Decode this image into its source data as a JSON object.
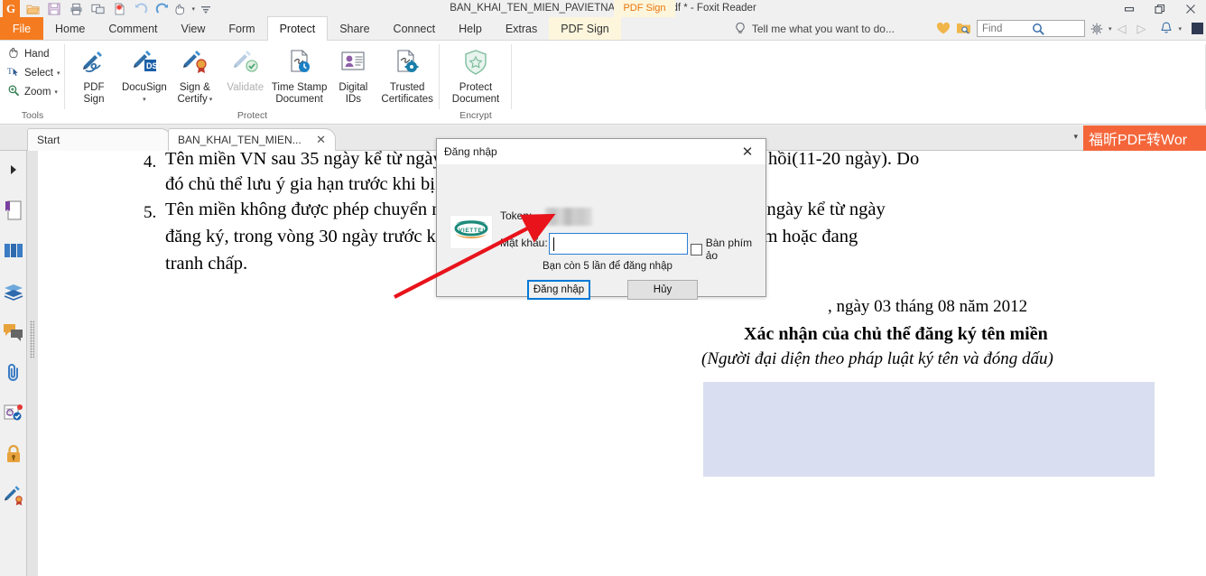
{
  "window": {
    "title": "BAN_KHAI_TEN_MIEN_PAVIETNAM.NET.VN.pdf * - Foxit Reader",
    "pdf_sign_badge": "PDF Sign",
    "quick_access": [
      {
        "name": "foxit-logo-icon",
        "glyph": "G"
      },
      {
        "name": "open-icon",
        "glyph": "▰"
      },
      {
        "name": "save-icon",
        "glyph": "▣"
      },
      {
        "name": "print-icon",
        "glyph": "⎙"
      },
      {
        "name": "email-icon",
        "glyph": "❐"
      },
      {
        "name": "new-from-clipboard-icon",
        "glyph": "⁂"
      },
      {
        "name": "undo-icon",
        "glyph": "↶"
      },
      {
        "name": "redo-icon",
        "glyph": "↷"
      },
      {
        "name": "hand-tool-icon",
        "glyph": "☚"
      },
      {
        "name": "customize-qat-icon",
        "glyph": "≡"
      }
    ],
    "controls": [
      {
        "name": "minimize-button",
        "glyph": "—"
      },
      {
        "name": "restore-button",
        "glyph": "❐"
      },
      {
        "name": "close-button",
        "glyph": "✕"
      }
    ]
  },
  "menu": {
    "file_label": "File",
    "items": [
      {
        "label": "Home",
        "active": false
      },
      {
        "label": "Comment",
        "active": false
      },
      {
        "label": "View",
        "active": false
      },
      {
        "label": "Form",
        "active": false
      },
      {
        "label": "Protect",
        "active": true
      },
      {
        "label": "Share",
        "active": false
      },
      {
        "label": "Connect",
        "active": false
      },
      {
        "label": "Help",
        "active": false
      },
      {
        "label": "Extras",
        "active": false
      },
      {
        "label": "PDF Sign",
        "active": false
      }
    ],
    "tell_me": "Tell me what you want to do...",
    "find_placeholder": "Find",
    "icons": {
      "lightbulb": "lightbulb-icon",
      "heart": "heart-icon",
      "folder_search": "folder-search-icon",
      "settings": "gear-icon",
      "prev": "back-arrow-icon",
      "next": "forward-arrow-icon",
      "bell": "bell-icon"
    }
  },
  "ribbon": {
    "groups": [
      {
        "label": "Tools",
        "buttons": [
          {
            "label": "Hand",
            "icon": "hand-icon",
            "caret": false,
            "disabled": false
          },
          {
            "label": "Select",
            "icon": "select-text-icon",
            "caret": true,
            "disabled": false
          },
          {
            "label": "Zoom",
            "icon": "zoom-icon",
            "caret": true,
            "disabled": false
          }
        ]
      },
      {
        "label": "Protect",
        "buttons": [
          {
            "label": "PDF\nSign",
            "line1": "PDF",
            "line2": "Sign",
            "icon": "pdf-sign-icon",
            "caret": false,
            "disabled": false
          },
          {
            "label": "DocuSign",
            "line1": "DocuSign",
            "line2": "",
            "icon": "docusign-icon",
            "caret": true,
            "disabled": false
          },
          {
            "label": "Sign & Certify",
            "line1": "Sign &",
            "line2": "Certify",
            "icon": "sign-certify-icon",
            "caret": true,
            "disabled": false
          },
          {
            "label": "Validate",
            "line1": "Validate",
            "line2": "",
            "icon": "validate-icon",
            "caret": false,
            "disabled": true
          },
          {
            "label": "Time Stamp Document",
            "line1": "Time Stamp",
            "line2": "Document",
            "icon": "time-stamp-icon",
            "caret": false,
            "disabled": false
          },
          {
            "label": "Digital IDs",
            "line1": "Digital",
            "line2": "IDs",
            "icon": "digital-ids-icon",
            "caret": false,
            "disabled": false
          },
          {
            "label": "Trusted Certificates",
            "line1": "Trusted",
            "line2": "Certificates",
            "icon": "trusted-certificates-icon",
            "caret": false,
            "disabled": false
          }
        ]
      },
      {
        "label": "Encrypt",
        "buttons": [
          {
            "label": "Protect Document",
            "line1": "Protect",
            "line2": "Document",
            "icon": "protect-document-icon",
            "caret": false,
            "disabled": false
          }
        ]
      }
    ]
  },
  "tabs": {
    "items": [
      {
        "label": "Start",
        "closable": false,
        "active": false
      },
      {
        "label": "BAN_KHAI_TEN_MIEN...",
        "closable": true,
        "active": true
      }
    ],
    "close_glyph": "✕",
    "overflow_caret": "▾",
    "promo_text": "福昕PDF转Wor"
  },
  "nav_rail": {
    "items": [
      {
        "name": "expand-panel-icon",
        "label": "Expand panel"
      },
      {
        "name": "bookmarks-icon",
        "label": "Bookmarks"
      },
      {
        "name": "pages-icon",
        "label": "Page Thumbnails"
      },
      {
        "name": "layers-icon",
        "label": "Layers"
      },
      {
        "name": "comments-icon",
        "label": "Comments"
      },
      {
        "name": "attachments-icon",
        "label": "Attachments"
      },
      {
        "name": "digital-signatures-icon",
        "label": "Digital Signatures"
      },
      {
        "name": "security-lock-icon",
        "label": "Security"
      },
      {
        "name": "sign-icon",
        "label": "Sign"
      }
    ]
  },
  "document": {
    "lines": [
      {
        "num": "4.",
        "text": "Tên miền VN sau 35 ngày kể từ ngày hết hạn sẽ chuyển sang trạng thái xử lý thu hồi(11-20 ngày). Do",
        "indent": 0
      },
      {
        "num": "",
        "text": "đó chủ thể lưu ý gia hạn trước khi bị thu hồi tên miền.",
        "indent": 1
      },
      {
        "num": "5.",
        "text": "Tên miền không được phép chuyển nhượng trong trường hợp sau: trong vòng 60 ngày kể từ ngày",
        "indent": 0
      },
      {
        "num": "",
        "text": "đăng ký, trong vòng 30 ngày trước khi hết hạn, đang bị tạm dừng để xử lý vi phạm hoặc đang",
        "indent": 1
      },
      {
        "num": "",
        "text": "tranh chấp.",
        "indent": 1
      }
    ],
    "signature_date": ", ngày 03 tháng 08 năm 2012",
    "signature_title": "Xác nhận của chủ thể đăng ký tên miền",
    "signature_subtitle": "(Người đại diện theo pháp luật ký tên và đóng dấu)",
    "highlight_color": "#d9dff0"
  },
  "dialog": {
    "title": "Đăng nhập",
    "close_glyph": "✕",
    "logo_name": "viettel-logo",
    "token_label": "Token:",
    "token_value": "",
    "password_label": "Mật khẩu:",
    "password_value": "",
    "virtual_keyboard_label": "Bàn phím ảo",
    "virtual_keyboard_checked": false,
    "attempts_text": "Bạn còn 5 lần để đăng nhập",
    "login_button": "Đăng nhập",
    "cancel_button": "Hủy"
  },
  "annotation": {
    "arrow_color": "#e8131b",
    "arrow_name": "red-pointer-arrow"
  },
  "colors": {
    "accent_orange": "#f47b20",
    "promo_orange": "#f4663a",
    "focus_blue": "#0078d7",
    "viettel_teal": "#1c8a7a",
    "viettel_orange": "#e98b22"
  }
}
